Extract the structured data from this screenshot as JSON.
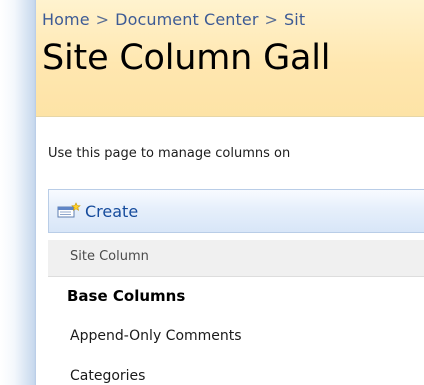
{
  "breadcrumb": {
    "items": [
      "Home",
      "Document Center",
      "Sit"
    ],
    "separator": ">"
  },
  "page": {
    "title": "Site Column Gall",
    "description": "Use this page to manage columns on"
  },
  "toolbar": {
    "create_label": "Create",
    "create_icon": "new-item-icon"
  },
  "list": {
    "column_header": "Site Column",
    "group_heading": "Base Columns",
    "items": [
      {
        "label": "Append-Only Comments"
      },
      {
        "label": "Categories"
      }
    ]
  },
  "colors": {
    "title_bar": "#ffe7b0",
    "link": "#3d5b95",
    "toolbar": "#e6effb",
    "create_text": "#154b9c"
  }
}
